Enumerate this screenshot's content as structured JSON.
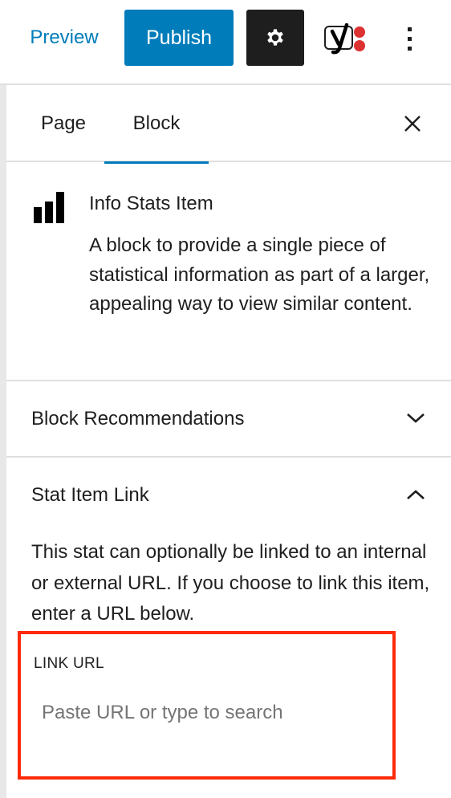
{
  "toolbar": {
    "preview_label": "Preview",
    "publish_label": "Publish",
    "settings_icon": "gear-icon",
    "yoast_icon": "yoast-seo-icon",
    "more_icon": "vertical-ellipsis-icon"
  },
  "sidebar": {
    "tabs": [
      {
        "label": "Page",
        "active": false
      },
      {
        "label": "Block",
        "active": true
      }
    ],
    "close_icon": "close-icon",
    "block_card": {
      "icon": "bar-chart-icon",
      "title": "Info Stats Item",
      "description": "A block to provide a single piece of statistical information as part of a larger, appealing way to view similar content."
    },
    "panels": [
      {
        "title": "Block Recommendations",
        "expanded": false,
        "chevron": "chevron-down-icon"
      },
      {
        "title": "Stat Item Link",
        "expanded": true,
        "chevron": "chevron-up-icon",
        "help_text": "This stat can optionally be linked to an internal or external URL. If you choose to link this item, enter a URL below.",
        "field": {
          "label": "Link URL",
          "value": "",
          "placeholder": "Paste URL or type to search"
        }
      }
    ]
  },
  "colors": {
    "accent": "#007cba",
    "dark": "#1e1e1e",
    "highlight": "#ff2a0a",
    "yoast_dot": "#dc3232",
    "border": "#e0e0e0"
  }
}
